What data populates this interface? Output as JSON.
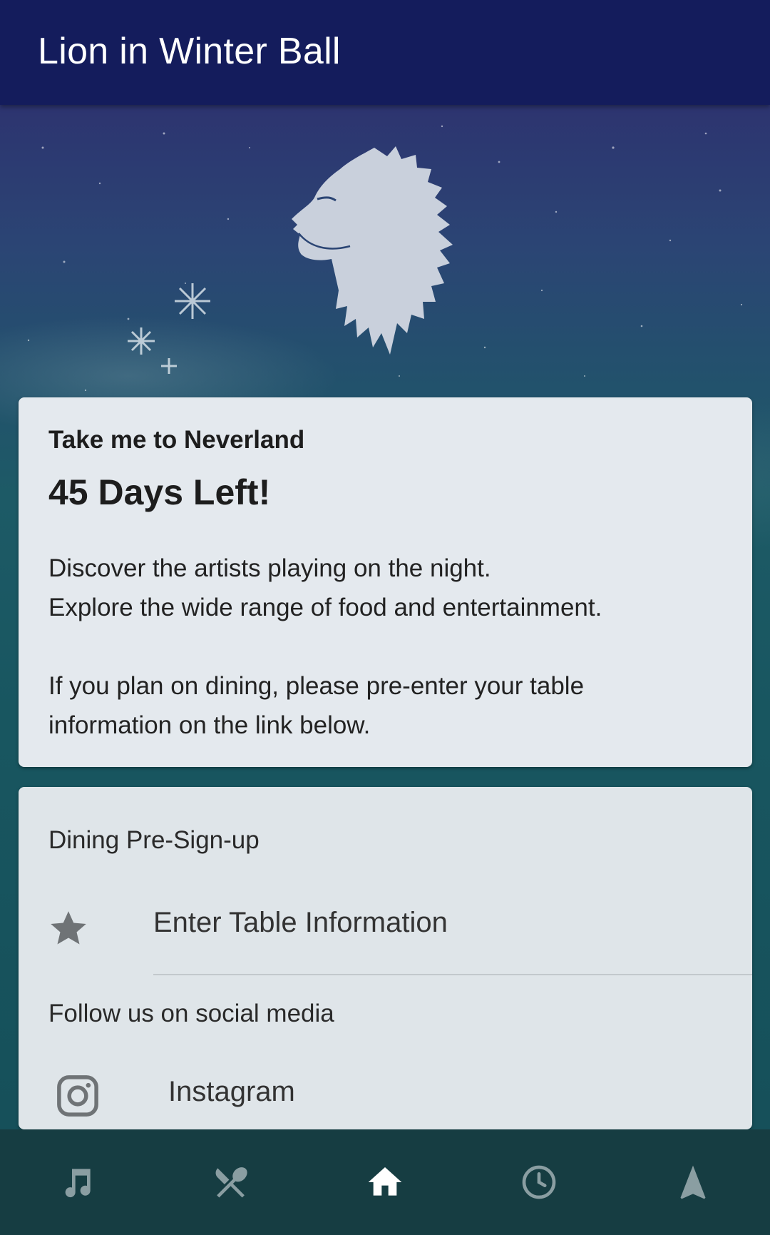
{
  "app": {
    "title": "Lion in Winter Ball"
  },
  "hero": {
    "image": "lion-head-logo"
  },
  "countdown_card": {
    "eyebrow": "Take me to Neverland",
    "headline": "45 Days Left!",
    "line1": "Discover the artists playing on the night.",
    "line2": "Explore the wide range of food and entertainment.",
    "line3": "If you plan on dining, please pre-enter your table information on the link below."
  },
  "links_card": {
    "dining_section_label": "Dining Pre-Sign-up",
    "dining_item": {
      "icon": "star-icon",
      "label": "Enter Table Information"
    },
    "social_section_label": "Follow us on social media",
    "social_item": {
      "icon": "instagram-icon",
      "label": "Instagram"
    }
  },
  "bottom_nav": {
    "items": [
      {
        "icon": "music-note-icon",
        "active": false
      },
      {
        "icon": "fork-knife-icon",
        "active": false
      },
      {
        "icon": "home-icon",
        "active": true
      },
      {
        "icon": "clock-icon",
        "active": false
      },
      {
        "icon": "navigation-arrow-icon",
        "active": false
      }
    ]
  },
  "colors": {
    "app_bar": "#141c5c",
    "card": "#e4e9ee",
    "bottom_nav": "#163d42",
    "nav_active": "#ffffff",
    "nav_inactive": "#8a9ea2"
  }
}
